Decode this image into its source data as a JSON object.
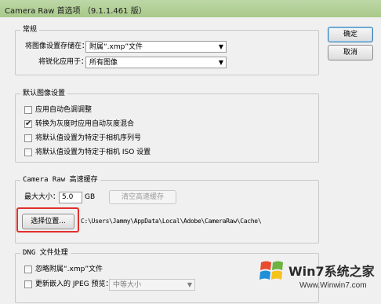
{
  "window": {
    "title": "Camera Raw 首选项 （9.1.1.461 版）"
  },
  "buttons": {
    "ok": "确定",
    "cancel": "取消"
  },
  "general": {
    "legend": "常规",
    "save_settings_label": "将图像设置存储在：",
    "save_settings_value": "附属“.xmp”文件",
    "sharpen_label": "将锐化应用于：",
    "sharpen_value": "所有图像"
  },
  "defaults": {
    "legend": "默认图像设置",
    "items": [
      {
        "label": "应用自动色调调整",
        "checked": false
      },
      {
        "label": "转换为灰度时应用自动灰度混合",
        "checked": true
      },
      {
        "label": "将默认值设置为特定于相机序列号",
        "checked": false
      },
      {
        "label": "将默认值设置为特定于相机 ISO 设置",
        "checked": false
      }
    ]
  },
  "cache": {
    "legend": "Camera Raw 高速缓存",
    "max_size_label": "最大大小：",
    "max_size_value": "5.0",
    "unit": "GB",
    "purge_button": "清空高速缓存",
    "select_location_button": "选择位置...",
    "path": "C:\\Users\\Jammy\\AppData\\Local\\Adobe\\CameraRaw\\Cache\\"
  },
  "dng": {
    "legend": "DNG 文件处理",
    "ignore_sidecar_label": "忽略附属“.xmp”文件",
    "ignore_sidecar_checked": false,
    "update_jpeg_label": "更新嵌入的 JPEG 预览：",
    "update_jpeg_checked": false,
    "preview_size_value": "中等大小"
  },
  "watermark": {
    "brand": "Win7系统之家",
    "url": "Www.Winwin7.com"
  },
  "colors": {
    "titlebar": "#b3d09a",
    "highlight": "#e0302c",
    "default_button_border": "#3c7fb1"
  }
}
